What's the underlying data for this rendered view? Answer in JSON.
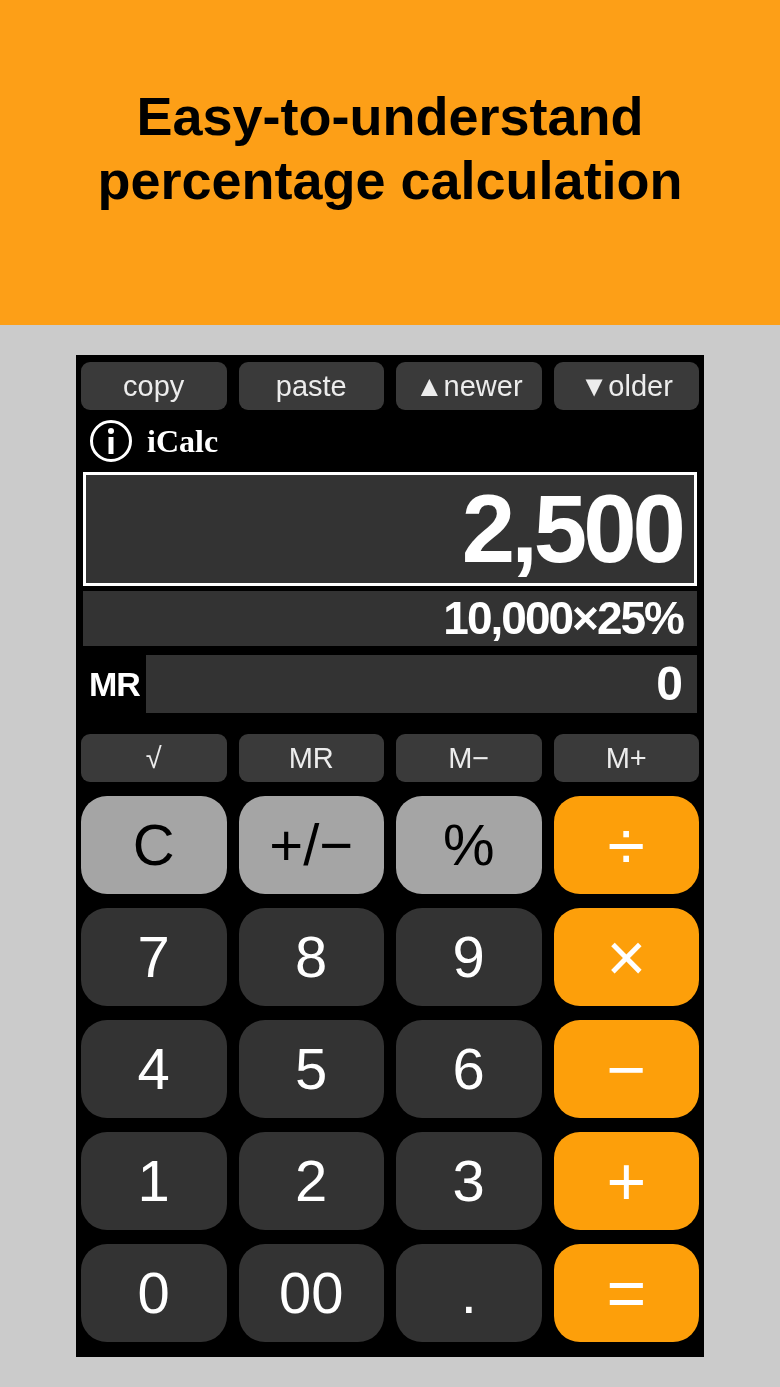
{
  "banner": {
    "lines": [
      "Easy-to-understand",
      "percentage calculation"
    ]
  },
  "toolbar": [
    {
      "label": "copy"
    },
    {
      "label": "paste"
    },
    {
      "label": "▲newer"
    },
    {
      "label": "▼older"
    }
  ],
  "app": {
    "title": "iCalc"
  },
  "display": {
    "value": "2,500",
    "expression": "10,000×25%"
  },
  "memory": {
    "label": "MR",
    "value": "0"
  },
  "memory_keys": [
    {
      "label": "√"
    },
    {
      "label": "MR"
    },
    {
      "label": "M−"
    },
    {
      "label": "M+"
    }
  ],
  "keys": [
    {
      "label": "C",
      "kind": "function"
    },
    {
      "label": "+/−",
      "kind": "function"
    },
    {
      "label": "%",
      "kind": "function"
    },
    {
      "label": "÷",
      "kind": "operator"
    },
    {
      "label": "7",
      "kind": "digit"
    },
    {
      "label": "8",
      "kind": "digit"
    },
    {
      "label": "9",
      "kind": "digit"
    },
    {
      "label": "×",
      "kind": "operator"
    },
    {
      "label": "4",
      "kind": "digit"
    },
    {
      "label": "5",
      "kind": "digit"
    },
    {
      "label": "6",
      "kind": "digit"
    },
    {
      "label": "−",
      "kind": "operator"
    },
    {
      "label": "1",
      "kind": "digit"
    },
    {
      "label": "2",
      "kind": "digit"
    },
    {
      "label": "3",
      "kind": "digit"
    },
    {
      "label": "+",
      "kind": "operator"
    },
    {
      "label": "0",
      "kind": "digit"
    },
    {
      "label": "00",
      "kind": "digit"
    },
    {
      "label": ".",
      "kind": "digit"
    },
    {
      "label": "=",
      "kind": "operator"
    }
  ]
}
